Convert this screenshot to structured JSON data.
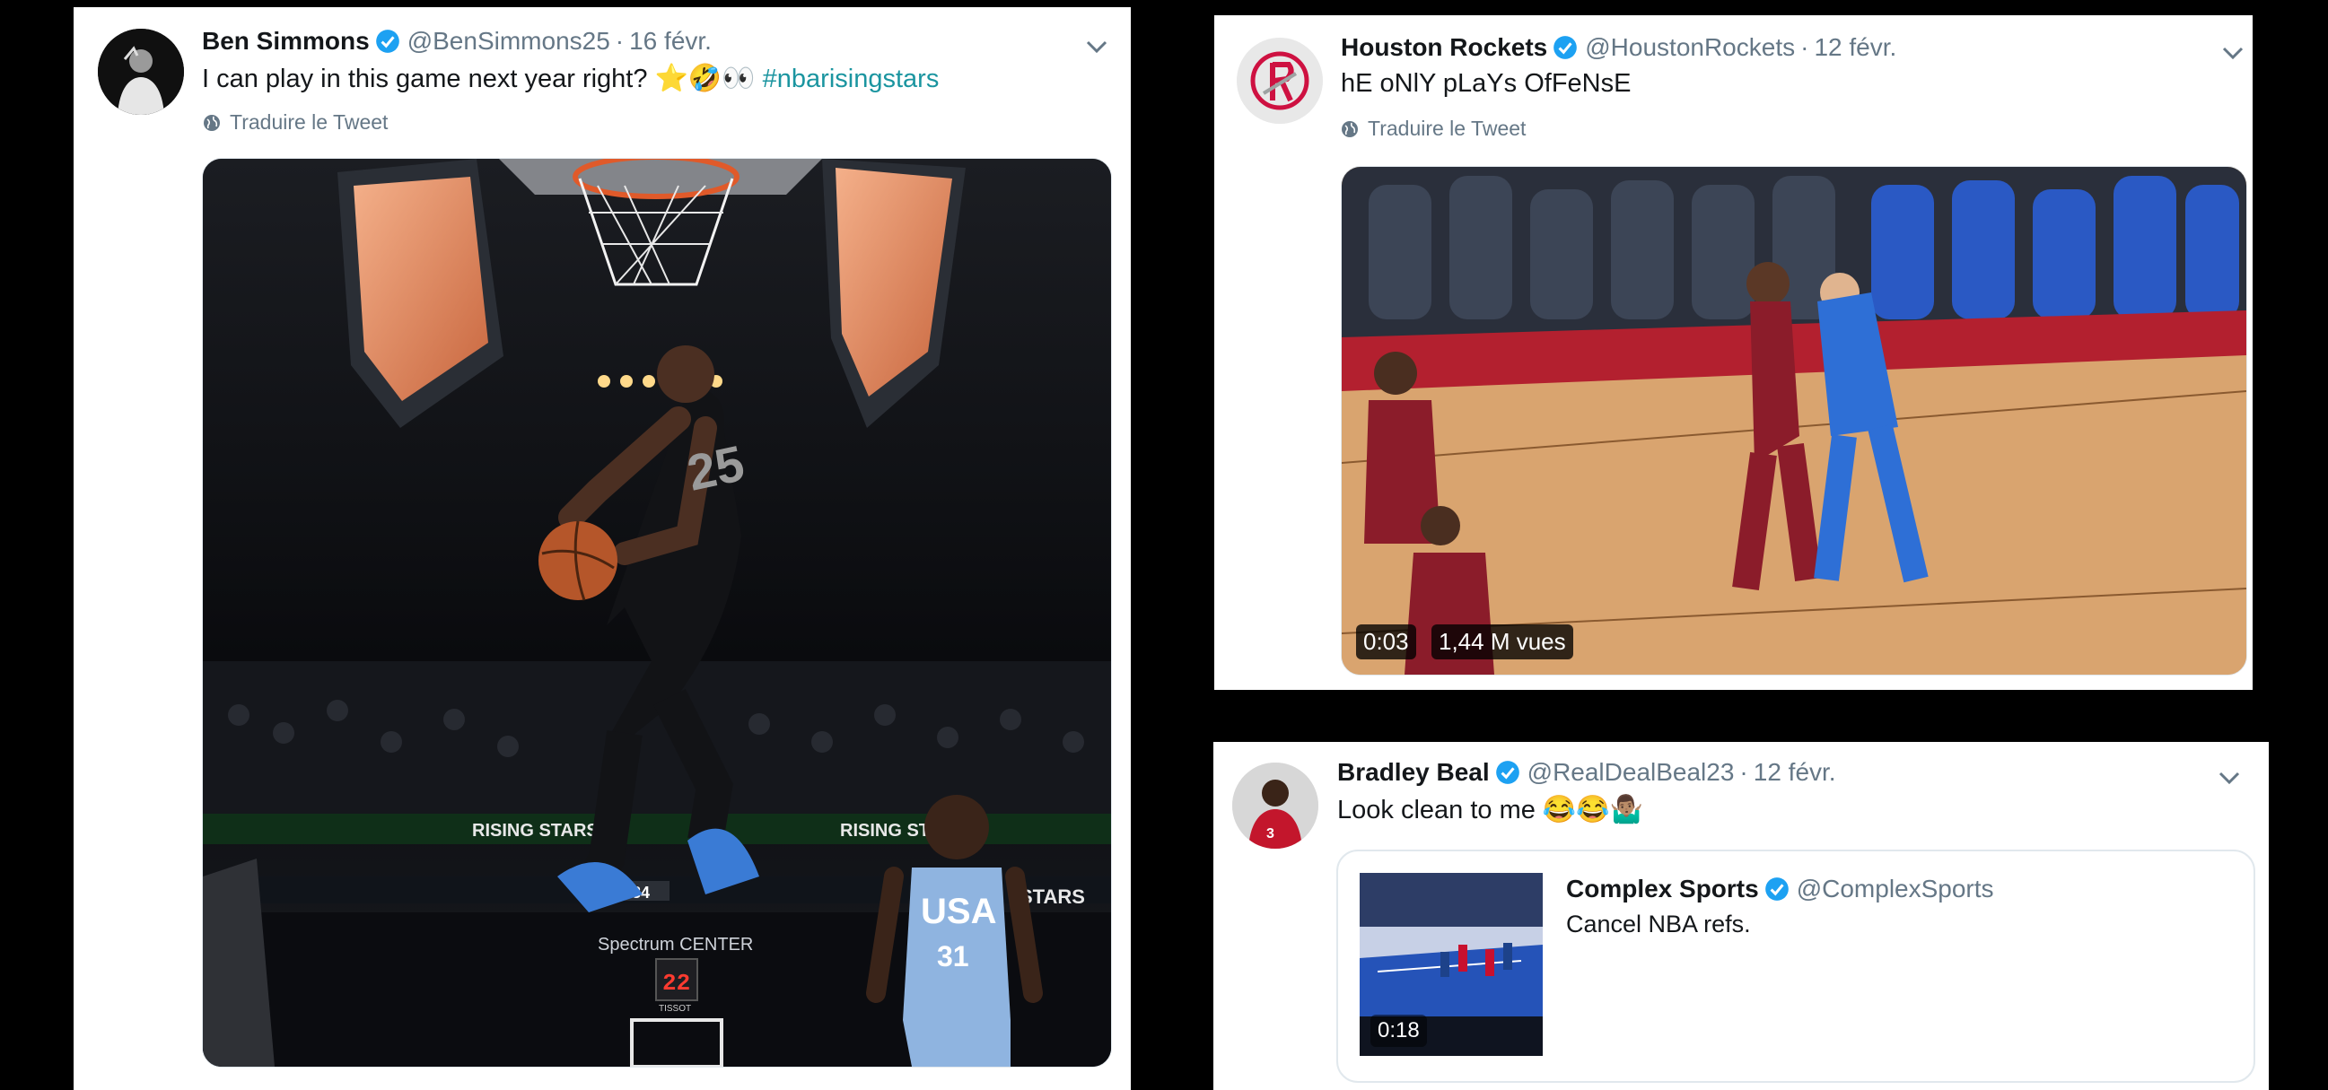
{
  "tweet1": {
    "name": "Ben Simmons",
    "handle": "@BenSimmons25",
    "separator": "·",
    "date": "16 févr.",
    "text": "I can play in this game next year right?",
    "emoji": "⭐🤣👀",
    "hashtag": "#nbarisingstars",
    "translate": "Traduire le Tweet",
    "image_text": {
      "banner_left": "RISING STARS",
      "banner_right": "RISING STARS",
      "banner_far_right": "STARS",
      "arena_sign": "Spectrum CENTER",
      "shot_clock": "22",
      "jersey_country": "USA",
      "jersey_number": "31",
      "jersey_dunker": "25",
      "score_home": "84",
      "sponsor": "TISSOT"
    }
  },
  "tweet2": {
    "name": "Houston Rockets",
    "handle": "@HoustonRockets",
    "separator": "·",
    "date": "12 févr.",
    "text": "hE oNlY pLaYs OfFeNsE",
    "translate": "Traduire le Tweet",
    "video_time": "0:03",
    "video_views": "1,44 M vues"
  },
  "tweet3": {
    "name": "Bradley Beal",
    "handle": "@RealDealBeal23",
    "separator": "·",
    "date": "12 févr.",
    "text": "Look clean to me",
    "emoji": "😂😂🤷🏽‍♂️",
    "quote": {
      "name": "Complex Sports",
      "handle": "@ComplexSports",
      "text": "Cancel NBA refs.",
      "video_time": "0:18"
    }
  },
  "colors": {
    "verified": "#1da1f2",
    "hashtag": "#1b95a0",
    "secondary_text": "#657786",
    "rockets_red": "#ce1141"
  }
}
